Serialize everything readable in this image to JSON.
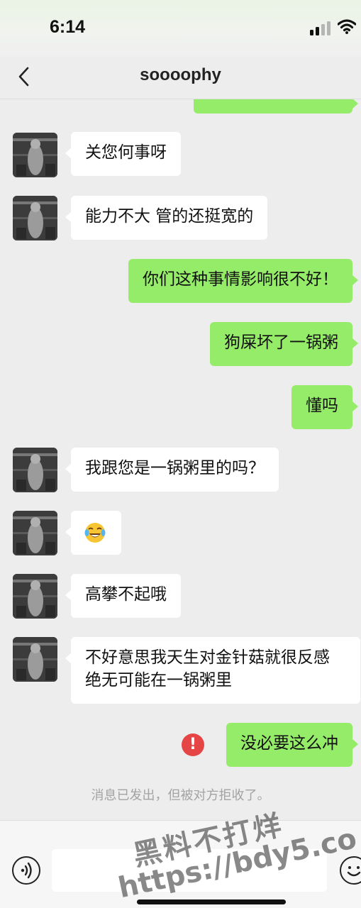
{
  "status_bar": {
    "time": "6:14"
  },
  "header": {
    "title": "soooophy"
  },
  "messages": [
    {
      "side": "out",
      "text": ""
    },
    {
      "side": "in",
      "text": "关您何事呀"
    },
    {
      "side": "in",
      "text": "能力不大 管的还挺宽的"
    },
    {
      "side": "out",
      "text": "你们这种事情影响很不好！"
    },
    {
      "side": "out",
      "text": "狗屎坏了一锅粥"
    },
    {
      "side": "out",
      "text": "懂吗"
    },
    {
      "side": "in",
      "text": "我跟您是一锅粥里的吗？"
    },
    {
      "side": "in",
      "text": "",
      "emoji": "tears-of-joy-emoji"
    },
    {
      "side": "in",
      "text": "高攀不起哦"
    },
    {
      "side": "in",
      "text": "不好意思我天生对金针菇就很反感 绝无可能在一锅粥里"
    },
    {
      "side": "out",
      "text": "没必要这么冲",
      "failed": true
    }
  ],
  "system_note": "消息已发出，但被对方拒收了。",
  "watermark": {
    "line1": "黑料不打烊",
    "line2": "https://bdy5.co"
  },
  "colors": {
    "incoming_bubble": "#ffffff",
    "outgoing_bubble": "#95ec69",
    "background": "#ededed",
    "error": "#e54545"
  },
  "icons": {
    "back": "chevron-left-icon",
    "voice": "voice-input-icon",
    "emoji": "emoji-icon",
    "error": "exclamation-icon"
  }
}
